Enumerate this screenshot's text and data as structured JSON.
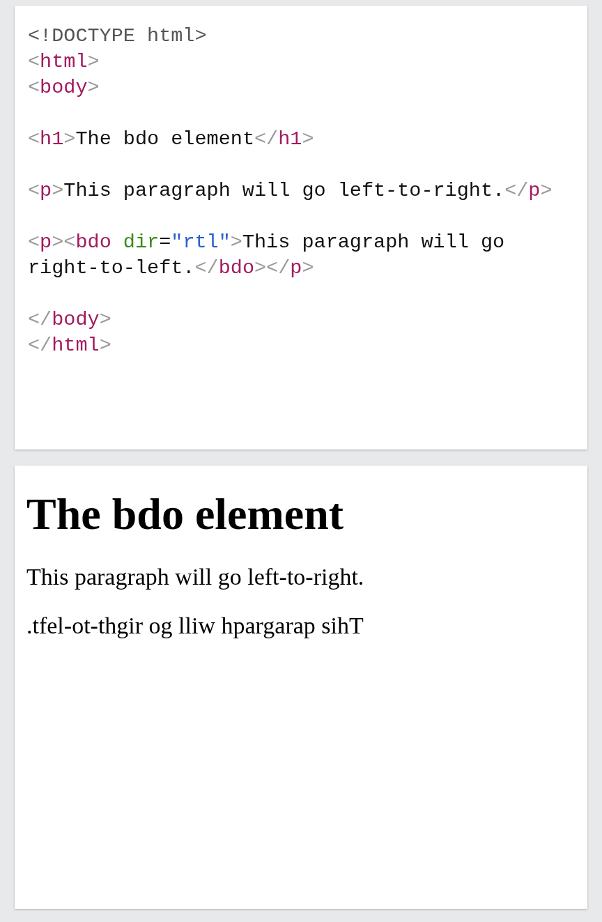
{
  "code_editor": {
    "blocks": [
      [
        [
          {
            "kind": "doctype",
            "text": "<!DOCTYPE html>"
          }
        ],
        [
          {
            "kind": "bracket",
            "text": "<"
          },
          {
            "kind": "tag",
            "text": "html"
          },
          {
            "kind": "bracket",
            "text": ">"
          }
        ],
        [
          {
            "kind": "bracket",
            "text": "<"
          },
          {
            "kind": "tag",
            "text": "body"
          },
          {
            "kind": "bracket",
            "text": ">"
          }
        ]
      ],
      [
        [
          {
            "kind": "bracket",
            "text": "<"
          },
          {
            "kind": "tag",
            "text": "h1"
          },
          {
            "kind": "bracket",
            "text": ">"
          },
          {
            "kind": "text",
            "text": "The bdo element"
          },
          {
            "kind": "bracket",
            "text": "</"
          },
          {
            "kind": "tag",
            "text": "h1"
          },
          {
            "kind": "bracket",
            "text": ">"
          }
        ]
      ],
      [
        [
          {
            "kind": "bracket",
            "text": "<"
          },
          {
            "kind": "tag",
            "text": "p"
          },
          {
            "kind": "bracket",
            "text": ">"
          },
          {
            "kind": "text",
            "text": "This paragraph will go left-to-right."
          },
          {
            "kind": "bracket",
            "text": "</"
          },
          {
            "kind": "tag",
            "text": "p"
          },
          {
            "kind": "bracket",
            "text": ">"
          }
        ]
      ],
      [
        [
          {
            "kind": "bracket",
            "text": "<"
          },
          {
            "kind": "tag",
            "text": "p"
          },
          {
            "kind": "bracket",
            "text": "><"
          },
          {
            "kind": "tag",
            "text": "bdo "
          },
          {
            "kind": "attr",
            "text": "dir"
          },
          {
            "kind": "text",
            "text": "="
          },
          {
            "kind": "value",
            "text": "\"rtl\""
          },
          {
            "kind": "bracket",
            "text": ">"
          },
          {
            "kind": "text",
            "text": "This paragraph will go right-to-left."
          },
          {
            "kind": "bracket",
            "text": "</"
          },
          {
            "kind": "tag",
            "text": "bdo"
          },
          {
            "kind": "bracket",
            "text": "></"
          },
          {
            "kind": "tag",
            "text": "p"
          },
          {
            "kind": "bracket",
            "text": ">"
          }
        ]
      ],
      [
        [
          {
            "kind": "bracket",
            "text": "</"
          },
          {
            "kind": "tag",
            "text": "body"
          },
          {
            "kind": "bracket",
            "text": ">"
          }
        ],
        [
          {
            "kind": "bracket",
            "text": "</"
          },
          {
            "kind": "tag",
            "text": "html"
          },
          {
            "kind": "bracket",
            "text": ">"
          }
        ]
      ]
    ]
  },
  "result": {
    "heading": "The bdo element",
    "paragraphs": [
      "This paragraph will go left-to-right.",
      ".tfel-ot-thgir og lliw hpargarap sihT"
    ]
  }
}
